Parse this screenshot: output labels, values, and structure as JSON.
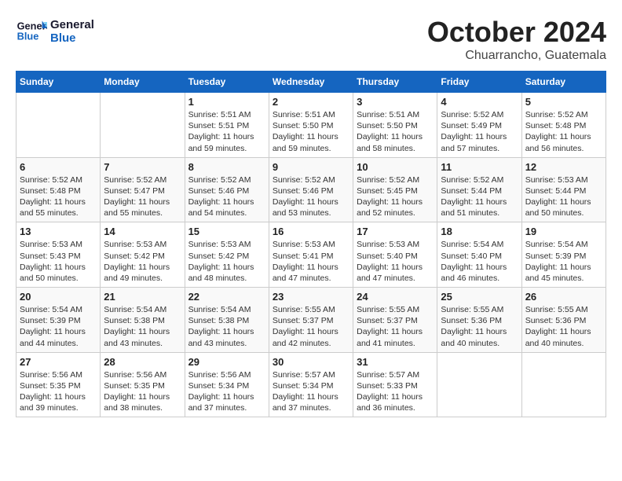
{
  "header": {
    "logo_line1": "General",
    "logo_line2": "Blue",
    "month": "October 2024",
    "location": "Chuarrancho, Guatemala"
  },
  "days_of_week": [
    "Sunday",
    "Monday",
    "Tuesday",
    "Wednesday",
    "Thursday",
    "Friday",
    "Saturday"
  ],
  "weeks": [
    [
      {
        "num": "",
        "detail": ""
      },
      {
        "num": "",
        "detail": ""
      },
      {
        "num": "1",
        "detail": "Sunrise: 5:51 AM\nSunset: 5:51 PM\nDaylight: 11 hours and 59 minutes."
      },
      {
        "num": "2",
        "detail": "Sunrise: 5:51 AM\nSunset: 5:50 PM\nDaylight: 11 hours and 59 minutes."
      },
      {
        "num": "3",
        "detail": "Sunrise: 5:51 AM\nSunset: 5:50 PM\nDaylight: 11 hours and 58 minutes."
      },
      {
        "num": "4",
        "detail": "Sunrise: 5:52 AM\nSunset: 5:49 PM\nDaylight: 11 hours and 57 minutes."
      },
      {
        "num": "5",
        "detail": "Sunrise: 5:52 AM\nSunset: 5:48 PM\nDaylight: 11 hours and 56 minutes."
      }
    ],
    [
      {
        "num": "6",
        "detail": "Sunrise: 5:52 AM\nSunset: 5:48 PM\nDaylight: 11 hours and 55 minutes."
      },
      {
        "num": "7",
        "detail": "Sunrise: 5:52 AM\nSunset: 5:47 PM\nDaylight: 11 hours and 55 minutes."
      },
      {
        "num": "8",
        "detail": "Sunrise: 5:52 AM\nSunset: 5:46 PM\nDaylight: 11 hours and 54 minutes."
      },
      {
        "num": "9",
        "detail": "Sunrise: 5:52 AM\nSunset: 5:46 PM\nDaylight: 11 hours and 53 minutes."
      },
      {
        "num": "10",
        "detail": "Sunrise: 5:52 AM\nSunset: 5:45 PM\nDaylight: 11 hours and 52 minutes."
      },
      {
        "num": "11",
        "detail": "Sunrise: 5:52 AM\nSunset: 5:44 PM\nDaylight: 11 hours and 51 minutes."
      },
      {
        "num": "12",
        "detail": "Sunrise: 5:53 AM\nSunset: 5:44 PM\nDaylight: 11 hours and 50 minutes."
      }
    ],
    [
      {
        "num": "13",
        "detail": "Sunrise: 5:53 AM\nSunset: 5:43 PM\nDaylight: 11 hours and 50 minutes."
      },
      {
        "num": "14",
        "detail": "Sunrise: 5:53 AM\nSunset: 5:42 PM\nDaylight: 11 hours and 49 minutes."
      },
      {
        "num": "15",
        "detail": "Sunrise: 5:53 AM\nSunset: 5:42 PM\nDaylight: 11 hours and 48 minutes."
      },
      {
        "num": "16",
        "detail": "Sunrise: 5:53 AM\nSunset: 5:41 PM\nDaylight: 11 hours and 47 minutes."
      },
      {
        "num": "17",
        "detail": "Sunrise: 5:53 AM\nSunset: 5:40 PM\nDaylight: 11 hours and 47 minutes."
      },
      {
        "num": "18",
        "detail": "Sunrise: 5:54 AM\nSunset: 5:40 PM\nDaylight: 11 hours and 46 minutes."
      },
      {
        "num": "19",
        "detail": "Sunrise: 5:54 AM\nSunset: 5:39 PM\nDaylight: 11 hours and 45 minutes."
      }
    ],
    [
      {
        "num": "20",
        "detail": "Sunrise: 5:54 AM\nSunset: 5:39 PM\nDaylight: 11 hours and 44 minutes."
      },
      {
        "num": "21",
        "detail": "Sunrise: 5:54 AM\nSunset: 5:38 PM\nDaylight: 11 hours and 43 minutes."
      },
      {
        "num": "22",
        "detail": "Sunrise: 5:54 AM\nSunset: 5:38 PM\nDaylight: 11 hours and 43 minutes."
      },
      {
        "num": "23",
        "detail": "Sunrise: 5:55 AM\nSunset: 5:37 PM\nDaylight: 11 hours and 42 minutes."
      },
      {
        "num": "24",
        "detail": "Sunrise: 5:55 AM\nSunset: 5:37 PM\nDaylight: 11 hours and 41 minutes."
      },
      {
        "num": "25",
        "detail": "Sunrise: 5:55 AM\nSunset: 5:36 PM\nDaylight: 11 hours and 40 minutes."
      },
      {
        "num": "26",
        "detail": "Sunrise: 5:55 AM\nSunset: 5:36 PM\nDaylight: 11 hours and 40 minutes."
      }
    ],
    [
      {
        "num": "27",
        "detail": "Sunrise: 5:56 AM\nSunset: 5:35 PM\nDaylight: 11 hours and 39 minutes."
      },
      {
        "num": "28",
        "detail": "Sunrise: 5:56 AM\nSunset: 5:35 PM\nDaylight: 11 hours and 38 minutes."
      },
      {
        "num": "29",
        "detail": "Sunrise: 5:56 AM\nSunset: 5:34 PM\nDaylight: 11 hours and 37 minutes."
      },
      {
        "num": "30",
        "detail": "Sunrise: 5:57 AM\nSunset: 5:34 PM\nDaylight: 11 hours and 37 minutes."
      },
      {
        "num": "31",
        "detail": "Sunrise: 5:57 AM\nSunset: 5:33 PM\nDaylight: 11 hours and 36 minutes."
      },
      {
        "num": "",
        "detail": ""
      },
      {
        "num": "",
        "detail": ""
      }
    ]
  ]
}
